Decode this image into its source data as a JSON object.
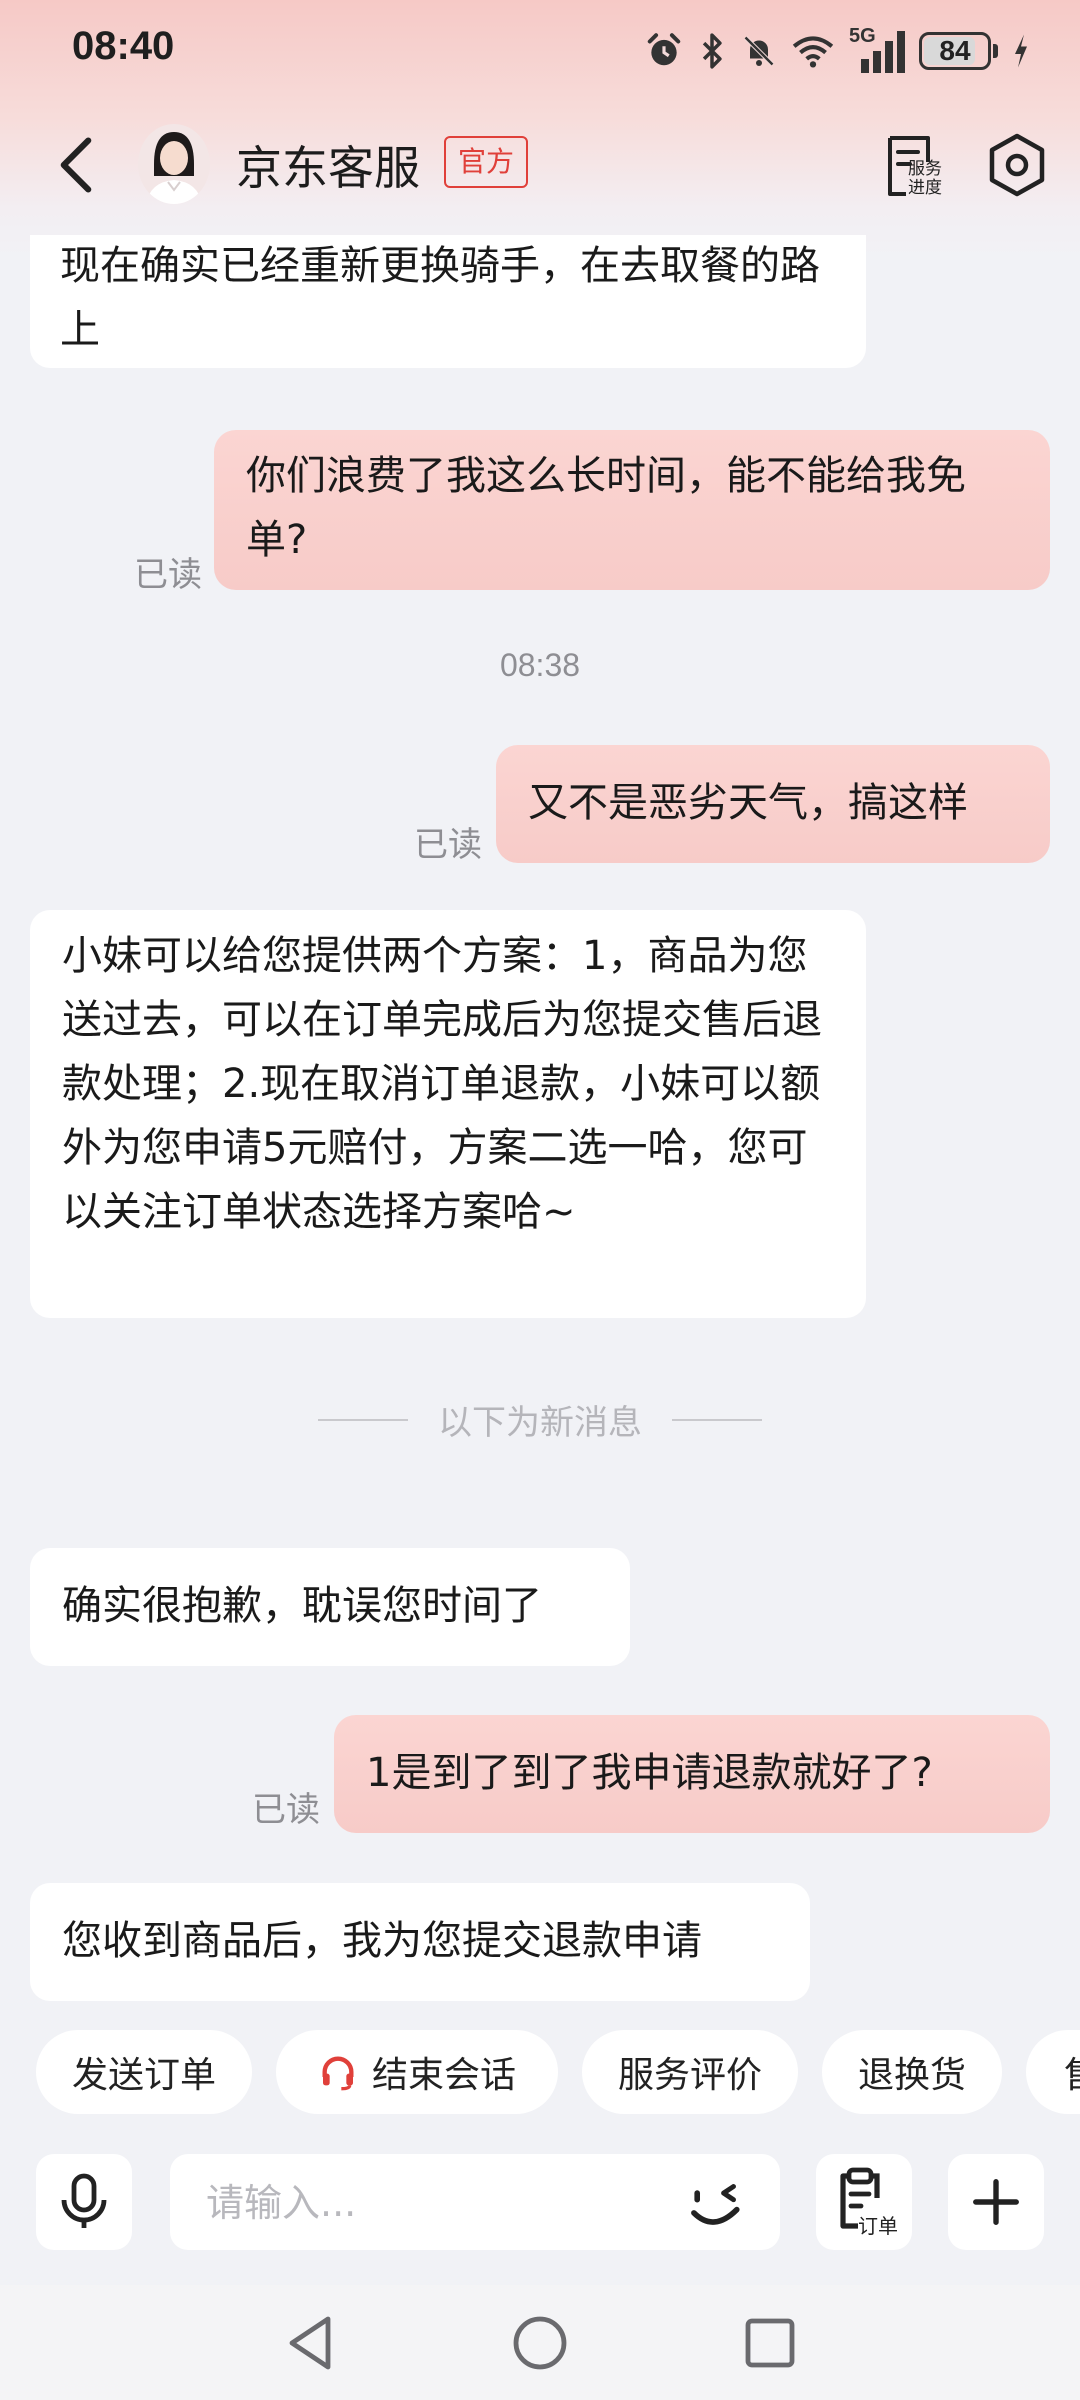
{
  "status_bar": {
    "time": "08:40",
    "network": "5G",
    "battery": "84",
    "battery_level": 0.84
  },
  "header": {
    "title": "京东客服",
    "badge": "官方",
    "service_progress_label": "服务进度"
  },
  "messages": [
    {
      "side": "in",
      "text": "现在确实已经重新更换骑手，在去取餐的路上"
    },
    {
      "side": "out",
      "text": "你们浪费了我这么长时间，能不能给我免单?",
      "read": "已读"
    },
    {
      "side": "time",
      "text": "08:38"
    },
    {
      "side": "out",
      "text": "又不是恶劣天气，搞这样",
      "read": "已读"
    },
    {
      "side": "in",
      "text": "小妹可以给您提供两个方案：1，商品为您送过去，可以在订单完成后为您提交售后退款处理；2.现在取消订单退款，小妹可以额外为您申请5元赔付，方案二选一哈，您可以关注订单状态选择方案哈~"
    },
    {
      "side": "divider",
      "text": "以下为新消息"
    },
    {
      "side": "in",
      "text": "确实很抱歉，耽误您时间了"
    },
    {
      "side": "out",
      "text": "1是到了到了我申请退款就好了?",
      "read": "已读"
    },
    {
      "side": "in",
      "text": "您收到商品后，我为您提交退款申请"
    }
  ],
  "quick_actions": [
    "发送订单",
    "结束会话",
    "服务评价",
    "退换货",
    "售"
  ],
  "input": {
    "placeholder": "请输入...",
    "order_label": "订单"
  },
  "colors": {
    "accent": "#e0403a",
    "bubble_out": "#f7cbc8",
    "bubble_in": "#ffffff",
    "background": "#f1f2f6"
  },
  "icons": [
    "back-arrow-icon",
    "service-progress-icon",
    "settings-icon",
    "microphone-icon",
    "emoji-icon",
    "order-icon",
    "plus-icon",
    "headset-icon"
  ]
}
